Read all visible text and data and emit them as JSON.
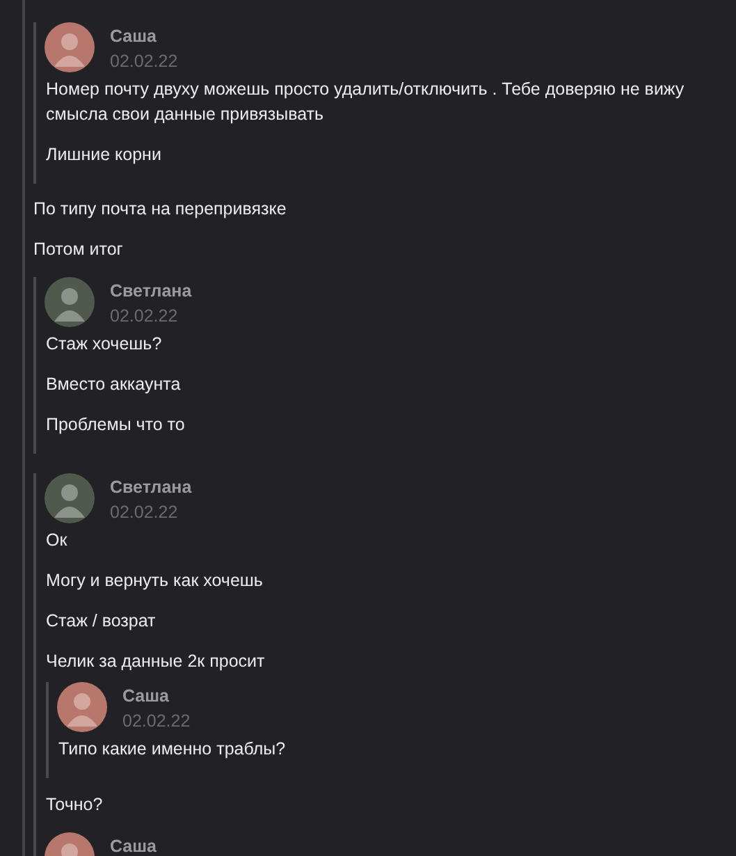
{
  "thread": [
    {
      "kind": "forward",
      "messages": [
        {
          "author": "Саша",
          "date": "02.02.22",
          "color": "#b7776c",
          "lines": [
            "Номер почту двуху можешь просто удалить/отключить . Тебе доверяю не вижу смысла свои данные привязывать",
            "Лишние корни"
          ]
        }
      ]
    },
    {
      "kind": "text",
      "text": "По типу почта на перепривязке"
    },
    {
      "kind": "text",
      "text": "Потом итог"
    },
    {
      "kind": "forward",
      "messages": [
        {
          "author": "Светлана",
          "date": "02.02.22",
          "color": "#4f5a4c",
          "lines": [
            "Стаж хочешь?",
            "Вместо аккаунта",
            "Проблемы что то"
          ]
        }
      ]
    },
    {
      "kind": "forward",
      "messages": [
        {
          "author": "Светлана",
          "date": "02.02.22",
          "color": "#4f5a4c",
          "lines": [
            "Ок",
            "Могу и вернуть как хочешь",
            "Стаж / возрат",
            "Челик за данные 2к просит"
          ],
          "forwards": [
            {
              "messages": [
                {
                  "author": "Саша",
                  "date": "02.02.22",
                  "color": "#b7776c",
                  "lines": [
                    "Типо какие именно траблы?"
                  ]
                }
              ]
            }
          ]
        },
        {
          "lines": [
            "Точно?"
          ]
        },
        {
          "author": "Саша",
          "color": "#b7776c"
        }
      ]
    }
  ]
}
